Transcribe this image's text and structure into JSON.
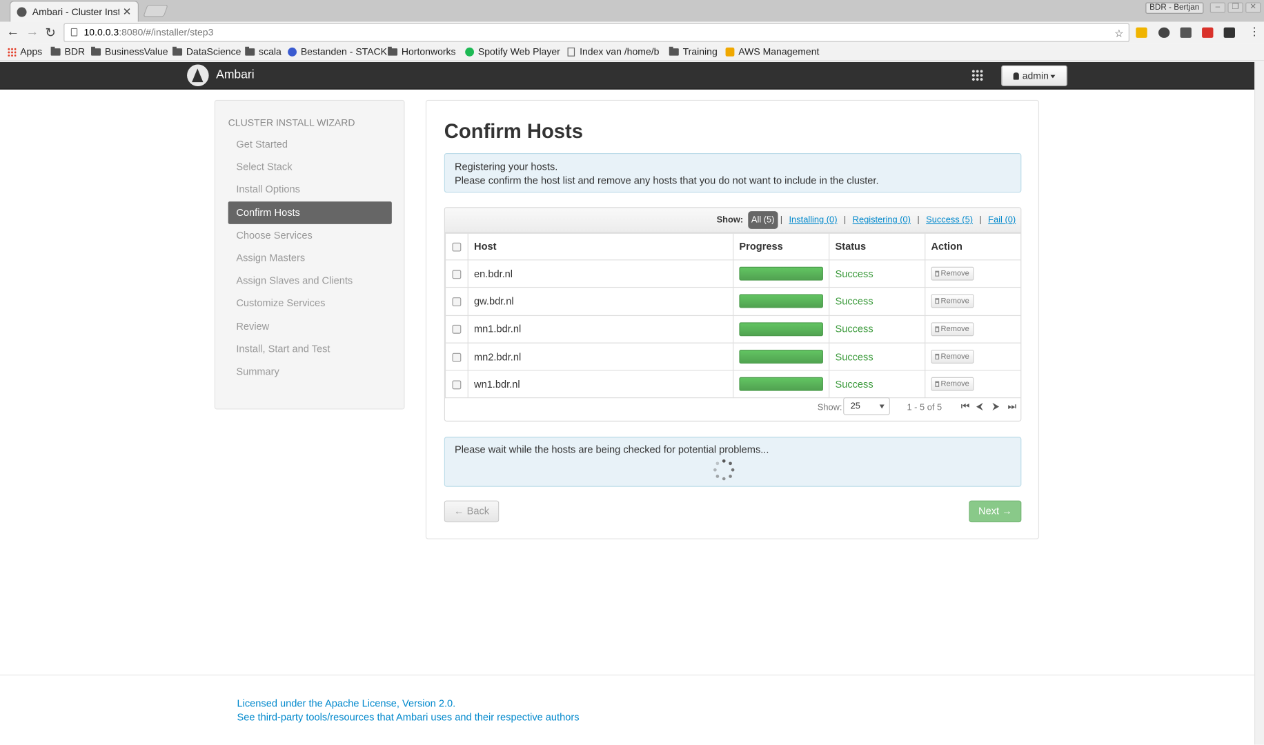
{
  "browser": {
    "tab_title": "Ambari - Cluster Install",
    "profile_name": "BDR - Bertjan",
    "url_host": "10.0.0.3",
    "url_rest": ":8080/#/installer/step3",
    "bookmarks": [
      "Apps",
      "BDR",
      "BusinessValue",
      "DataScience",
      "scala",
      "Bestanden - STACK",
      "Hortonworks",
      "Spotify Web Player",
      "Index van /home/b",
      "Training",
      "AWS Management"
    ]
  },
  "app": {
    "brand": "Ambari",
    "user_label": "admin"
  },
  "wizard": {
    "title": "CLUSTER INSTALL WIZARD",
    "steps": [
      "Get Started",
      "Select Stack",
      "Install Options",
      "Confirm Hosts",
      "Choose Services",
      "Assign Masters",
      "Assign Slaves and Clients",
      "Customize Services",
      "Review",
      "Install, Start and Test",
      "Summary"
    ],
    "active_step": "Confirm Hosts"
  },
  "main": {
    "title": "Confirm Hosts",
    "alert_line1": "Registering your hosts.",
    "alert_line2": "Please confirm the host list and remove any hosts that you do not want to include in the cluster.",
    "filter_label": "Show:",
    "filters": [
      "All (5)",
      "Installing (0)",
      "Registering (0)",
      "Success (5)",
      "Fail (0)"
    ],
    "columns": [
      "Host",
      "Progress",
      "Status",
      "Action"
    ],
    "rows": [
      {
        "host": "en.bdr.nl",
        "progress": 1.0,
        "status": "Success",
        "action": "Remove"
      },
      {
        "host": "gw.bdr.nl",
        "progress": 1.0,
        "status": "Success",
        "action": "Remove"
      },
      {
        "host": "mn1.bdr.nl",
        "progress": 1.0,
        "status": "Success",
        "action": "Remove"
      },
      {
        "host": "mn2.bdr.nl",
        "progress": 1.0,
        "status": "Success",
        "action": "Remove"
      },
      {
        "host": "wn1.bdr.nl",
        "progress": 1.0,
        "status": "Success",
        "action": "Remove"
      }
    ],
    "pager_label": "Show:",
    "page_size": "25",
    "range_text": "1 - 5 of 5",
    "check_message": "Please wait while the hosts are being checked for potential problems...",
    "back_label": "← Back",
    "next_label": "Next →"
  },
  "footer": {
    "license": "Licensed under the Apache License, Version 2.0.",
    "thirdparty": "See third-party tools/resources that Ambari uses and their respective authors"
  },
  "colors": {
    "navbar": "#313131",
    "success": "#3b9a3b",
    "progress": "#5cb85c",
    "link": "#0088cc"
  }
}
